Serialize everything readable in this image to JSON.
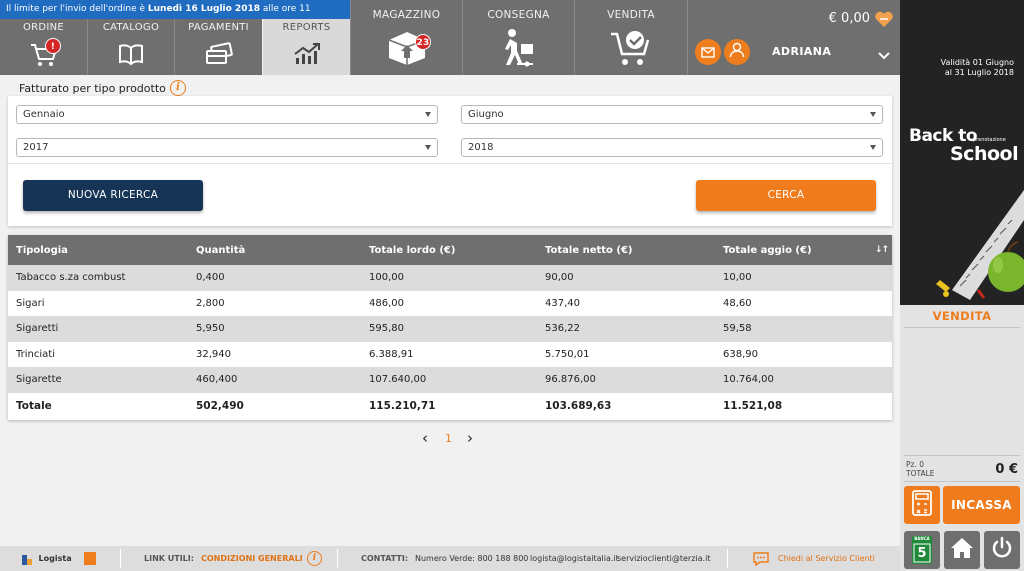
{
  "notice": {
    "prefix": "Il limite per l'invio dell'ordine è ",
    "bold_date": "Lunedì 16 Luglio 2018",
    "suffix": " alle ore 11"
  },
  "nav": {
    "tabs": [
      {
        "label": "ORDINE",
        "icon": "cart-icon",
        "badge": "!"
      },
      {
        "label": "CATALOGO",
        "icon": "book-icon"
      },
      {
        "label": "PAGAMENTI",
        "icon": "credit-cards-icon"
      },
      {
        "label": "REPORTS",
        "icon": "trend-chart-icon",
        "active": true
      },
      {
        "label": "MAGAZZINO",
        "icon": "box-icon",
        "badge": "23"
      },
      {
        "label": "CONSEGNA",
        "icon": "delivery-person-icon"
      },
      {
        "label": "VENDITA",
        "icon": "cart-check-icon"
      }
    ]
  },
  "user": {
    "cart_amount": "€ 0,00",
    "name": "ADRIANA"
  },
  "report": {
    "title": "Fatturato per tipo prodotto",
    "filters": {
      "from_month": "Gennaio",
      "to_month": "Giugno",
      "from_year": "2017",
      "to_year": "2018"
    },
    "new_search_label": "NUOVA RICERCA",
    "search_label": "CERCA"
  },
  "table": {
    "columns": [
      "Tipologia",
      "Quantità",
      "Totale lordo (€)",
      "Totale netto (€)",
      "Totale aggio (€)"
    ],
    "sort_label": "↓↑",
    "rows": [
      [
        "Tabacco s.za combust",
        "0,400",
        "100,00",
        "90,00",
        "10,00"
      ],
      [
        "Sigari",
        "2,800",
        "486,00",
        "437,40",
        "48,60"
      ],
      [
        "Sigaretti",
        "5,950",
        "595,80",
        "536,22",
        "59,58"
      ],
      [
        "Trinciati",
        "32,940",
        "6.388,91",
        "5.750,01",
        "638,90"
      ],
      [
        "Sigarette",
        "460,400",
        "107.640,00",
        "96.876,00",
        "10.764,00"
      ]
    ],
    "total": [
      "Totale",
      "502,490",
      "115.210,71",
      "103.689,63",
      "11.521,08"
    ]
  },
  "pager": {
    "prev": "‹",
    "current": "1",
    "next": "›"
  },
  "promo": {
    "validity_line1": "Validità 01 Giugno",
    "validity_line2": "al 31 Luglio 2018",
    "title1": "Back to",
    "title2": "School",
    "tag": "prenotazione"
  },
  "side": {
    "vendita_label": "VENDITA",
    "pz_label": "Pz. 0",
    "totale_label": "TOTALE",
    "total_value": "0 €",
    "incassa_label": "INCASSA",
    "banca_label": "BANCA",
    "banca_number": "5"
  },
  "footer": {
    "logo_text": "Logista",
    "links_label": "LINK UTILI:",
    "conditions_label": "CONDIZIONI GENERALI",
    "contacts_label": "CONTATTI:",
    "phone": "Numero Verde: 800 188 800",
    "email1": "logista@logistaitalia.it",
    "email2": "servizioclienti@terzia.it",
    "chat_label": "Chiedi al Servizio Clienti"
  },
  "colors": {
    "accent": "#ef7b1c",
    "dark_blue": "#163456",
    "nav_gray": "#6f6f6f",
    "notice_blue": "#1f6cc0"
  }
}
